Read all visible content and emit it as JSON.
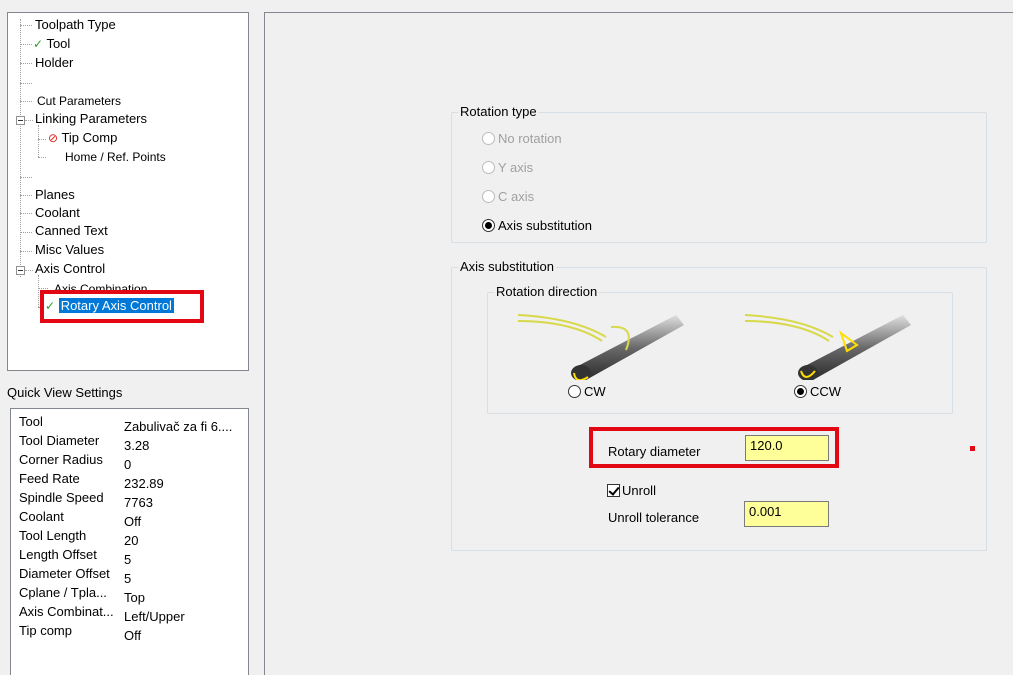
{
  "tree": {
    "items": [
      {
        "label": "Toolpath Type",
        "status": ""
      },
      {
        "label": "Tool",
        "status": "check"
      },
      {
        "label": "Holder",
        "status": ""
      },
      {
        "label": "Cut Parameters",
        "status": ""
      },
      {
        "label": "Linking Parameters",
        "status": ""
      },
      {
        "label": "Tip Comp",
        "status": "no"
      },
      {
        "label": "Home / Ref. Points",
        "status": ""
      },
      {
        "label": "Planes",
        "status": ""
      },
      {
        "label": "Coolant",
        "status": ""
      },
      {
        "label": "Canned Text",
        "status": ""
      },
      {
        "label": "Misc Values",
        "status": ""
      },
      {
        "label": "Axis Control",
        "status": ""
      },
      {
        "label": "Axis Combination",
        "status": ""
      },
      {
        "label": "Rotary Axis Control",
        "status": "check",
        "selected": true
      }
    ],
    "check_glyph": "✓",
    "no_glyph": "⊘"
  },
  "quick_view": {
    "title": "Quick View Settings",
    "rows": [
      {
        "key": "Tool",
        "value": "Zabulivač za fi 6...."
      },
      {
        "key": "Tool Diameter",
        "value": "3.28"
      },
      {
        "key": "Corner Radius",
        "value": "0"
      },
      {
        "key": "Feed Rate",
        "value": "232.89"
      },
      {
        "key": "Spindle Speed",
        "value": "7763"
      },
      {
        "key": "Coolant",
        "value": "Off"
      },
      {
        "key": "Tool Length",
        "value": "20"
      },
      {
        "key": "Length Offset",
        "value": "5"
      },
      {
        "key": "Diameter Offset",
        "value": "5"
      },
      {
        "key": "Cplane / Tpla...",
        "value": "Top"
      },
      {
        "key": "Axis Combinat...",
        "value": "Left/Upper"
      },
      {
        "key": "Tip comp",
        "value": "Off"
      }
    ]
  },
  "rotation_type": {
    "title": "Rotation type",
    "options": [
      {
        "label": "No rotation",
        "enabled": false,
        "selected": false
      },
      {
        "label": "Y axis",
        "enabled": false,
        "selected": false
      },
      {
        "label": "C axis",
        "enabled": false,
        "selected": false
      },
      {
        "label": "Axis substitution",
        "enabled": true,
        "selected": true
      }
    ]
  },
  "axis_substitution": {
    "title": "Axis substitution",
    "rotation_direction": {
      "title": "Rotation direction",
      "cw_label": "CW",
      "ccw_label": "CCW",
      "selected": "CCW"
    },
    "rotary_diameter_label": "Rotary diameter",
    "rotary_diameter_value": "120.0",
    "unroll_label": "Unroll",
    "unroll_checked": true,
    "unroll_tolerance_label": "Unroll tolerance",
    "unroll_tolerance_value": "0.001"
  },
  "colors": {
    "highlight": "#e30613",
    "selection": "#0078d7",
    "field_bg": "#ffff99"
  }
}
